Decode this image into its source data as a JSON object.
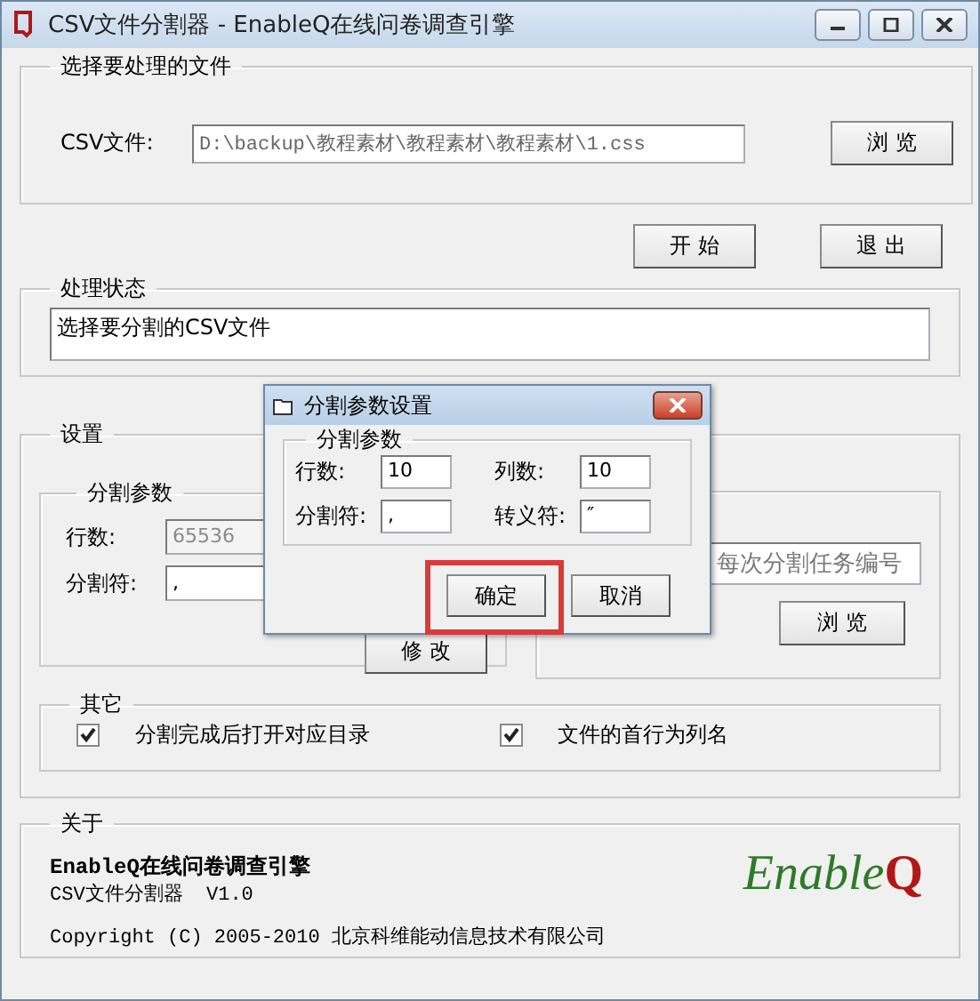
{
  "window": {
    "title": "CSV文件分割器 - EnableQ在线问卷调查引擎"
  },
  "file_section": {
    "title": "选择要处理的文件",
    "label": "CSV文件:",
    "value": "D:\\backup\\教程素材\\教程素材\\教程素材\\1.css",
    "browse": "浏 览"
  },
  "actions": [
    "开 始",
    "退 出"
  ],
  "status": {
    "title": "处理状态",
    "text": "选择要分割的CSV文件"
  },
  "settings": {
    "title": "设置",
    "split_params": {
      "title": "分割参数",
      "rows_label": "行数:",
      "rows_value": "65536",
      "rows_disabled": true,
      "delimiter_label": "分割符:",
      "delimiter_value": ",",
      "modify": "修 改"
    },
    "task": {
      "placeholder": "每次分割任务编号",
      "browse": "浏 览"
    },
    "other": {
      "title": "其它",
      "options": [
        {
          "label": "分割完成后打开对应目录",
          "checked": true
        },
        {
          "label": "文件的首行为列名",
          "checked": true
        }
      ]
    }
  },
  "about": {
    "title": "关于",
    "product": "EnableQ在线问卷调查引擎",
    "version": "CSV文件分割器  V1.0",
    "copyright": "Copyright (C) 2005-2010 北京科维能动信息技术有限公司",
    "logo": "EnableQ"
  },
  "dialog": {
    "title": "分割参数设置",
    "group": "分割参数",
    "fields": [
      {
        "label": "行数:",
        "value": "10"
      },
      {
        "label": "列数:",
        "value": "10"
      },
      {
        "label": "分割符:",
        "value": ","
      },
      {
        "label": "转义符:",
        "value": "″"
      }
    ],
    "buttons": [
      {
        "label": "确定",
        "highlighted": true
      },
      {
        "label": "取消",
        "highlighted": false
      }
    ]
  }
}
